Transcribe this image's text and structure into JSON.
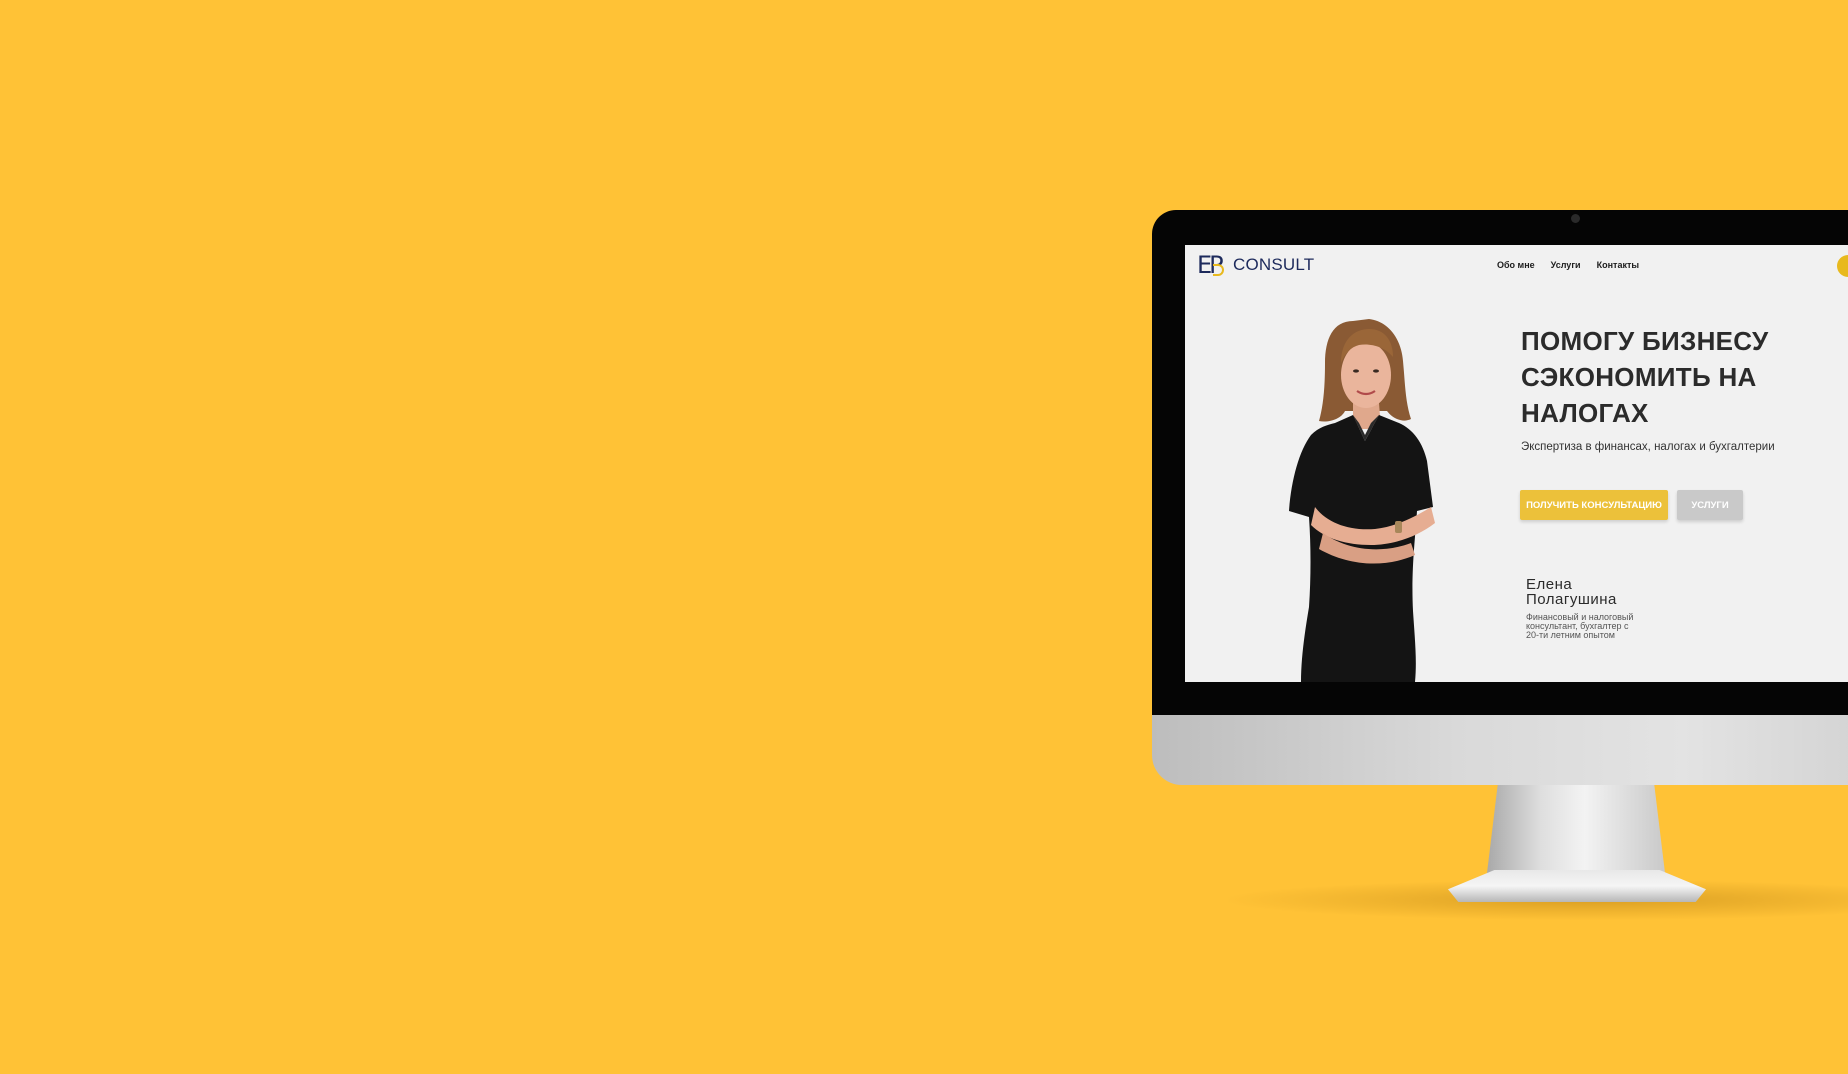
{
  "site": {
    "logo_text": "CONSULT",
    "logo_mark": "EP",
    "nav": [
      "Обо мне",
      "Услуги",
      "Контакты"
    ]
  },
  "hero": {
    "title_lines": [
      "ПОМОГУ БИЗНЕСУ",
      "СЭКОНОМИТЬ НА",
      "НАЛОГАХ"
    ],
    "subtitle": "Экспертиза в финансах, налогах и бухгалтерии",
    "primary_button": "ПОЛУЧИТЬ КОНСУЛЬТАЦИЮ",
    "secondary_button": "УСЛУГИ"
  },
  "person": {
    "name_line1": "Елена",
    "name_line2": "Полагушина",
    "desc_line1": "Финансовый и налоговый",
    "desc_line2": "консультант, бухгалтер с",
    "desc_line3": "20-ти летним опытом"
  },
  "colors": {
    "background": "#ffc236",
    "accent": "#ecc13a",
    "logo_blue": "#1d2a5c",
    "screen_bg": "#f1f1f1"
  },
  "icons": {
    "monitor": "imac-monitor-icon",
    "logo": "ep-logo-icon"
  }
}
